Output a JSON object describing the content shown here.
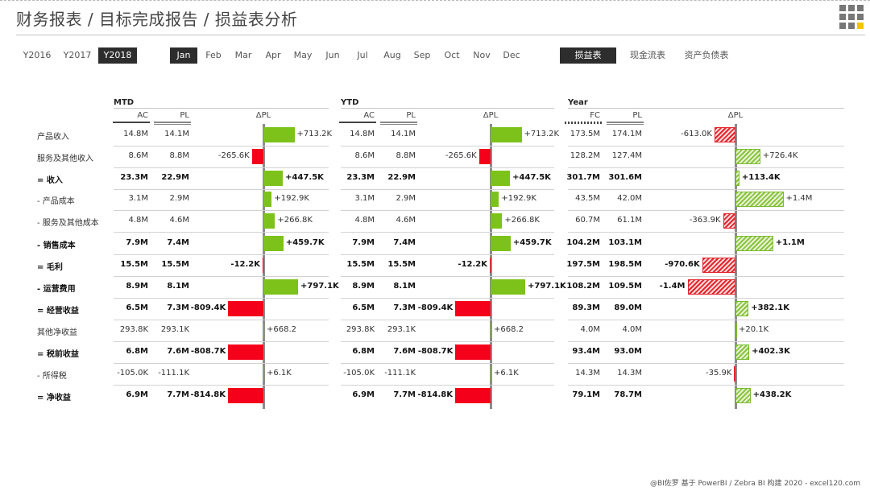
{
  "title": "财务报表 / 目标完成报告 / 损益表分析",
  "years": [
    {
      "label": "Y2016",
      "active": false
    },
    {
      "label": "Y2017",
      "active": false
    },
    {
      "label": "Y2018",
      "active": true
    }
  ],
  "months": [
    {
      "label": "Jan",
      "active": true
    },
    {
      "label": "Feb",
      "active": false
    },
    {
      "label": "Mar",
      "active": false
    },
    {
      "label": "Apr",
      "active": false
    },
    {
      "label": "May",
      "active": false
    },
    {
      "label": "Jun",
      "active": false
    },
    {
      "label": "Jul",
      "active": false
    },
    {
      "label": "Aug",
      "active": false
    },
    {
      "label": "Sep",
      "active": false
    },
    {
      "label": "Oct",
      "active": false
    },
    {
      "label": "Nov",
      "active": false
    },
    {
      "label": "Dec",
      "active": false
    }
  ],
  "reports": [
    {
      "label": "损益表",
      "active": true
    },
    {
      "label": "现金流表",
      "active": false
    },
    {
      "label": "资产负债表",
      "active": false
    }
  ],
  "rows": [
    {
      "label": "产品收入",
      "bold": false
    },
    {
      "label": "服务及其他收入",
      "bold": false
    },
    {
      "label": "= 收入",
      "bold": true
    },
    {
      "label": "- 产品成本",
      "bold": false
    },
    {
      "label": "- 服务及其他成本",
      "bold": false
    },
    {
      "label": "- 销售成本",
      "bold": true
    },
    {
      "label": "= 毛利",
      "bold": true
    },
    {
      "label": "- 运营费用",
      "bold": true
    },
    {
      "label": "= 经营收益",
      "bold": true
    },
    {
      "label": "其他净收益",
      "bold": false
    },
    {
      "label": "= 税前收益",
      "bold": true
    },
    {
      "label": "- 所得税",
      "bold": false
    },
    {
      "label": "= 净收益",
      "bold": true
    }
  ],
  "sections": [
    {
      "label": "MTD",
      "col1": "AC",
      "col2": "PL",
      "delta": "ΔPL",
      "c1": [
        "14.8M",
        "8.6M",
        "23.3M",
        "3.1M",
        "4.8M",
        "7.9M",
        "15.5M",
        "8.9M",
        "6.5M",
        "293.8K",
        "6.8M",
        "-105.0K",
        "6.9M"
      ],
      "c2": [
        "14.1M",
        "8.8M",
        "22.9M",
        "2.9M",
        "4.6M",
        "7.4M",
        "15.5M",
        "8.1M",
        "7.3M",
        "293.1K",
        "7.6M",
        "-111.1K",
        "7.7M"
      ],
      "delta_labels": [
        "+713.2K",
        "-265.6K",
        "+447.5K",
        "+192.9K",
        "+266.8K",
        "+459.7K",
        "-12.2K",
        "+797.1K",
        "-809.4K",
        "+668.2",
        "-808.7K",
        "+6.1K",
        "-814.8K"
      ]
    },
    {
      "label": "YTD",
      "col1": "AC",
      "col2": "PL",
      "delta": "ΔPL",
      "c1": [
        "14.8M",
        "8.6M",
        "23.3M",
        "3.1M",
        "4.8M",
        "7.9M",
        "15.5M",
        "8.9M",
        "6.5M",
        "293.8K",
        "6.8M",
        "-105.0K",
        "6.9M"
      ],
      "c2": [
        "14.1M",
        "8.8M",
        "22.9M",
        "2.9M",
        "4.6M",
        "7.4M",
        "15.5M",
        "8.1M",
        "7.3M",
        "293.1K",
        "7.6M",
        "-111.1K",
        "7.7M"
      ],
      "delta_labels": [
        "+713.2K",
        "-265.6K",
        "+447.5K",
        "+192.9K",
        "+266.8K",
        "+459.7K",
        "-12.2K",
        "+797.1K",
        "-809.4K",
        "+668.2",
        "-808.7K",
        "+6.1K",
        "-814.8K"
      ]
    },
    {
      "label": "Year",
      "col1": "FC",
      "col2": "PL",
      "delta": "ΔPL",
      "c1": [
        "173.5M",
        "128.2M",
        "301.7M",
        "43.5M",
        "60.7M",
        "104.2M",
        "197.5M",
        "108.2M",
        "89.3M",
        "4.0M",
        "93.4M",
        "14.3M",
        "79.1M"
      ],
      "c2": [
        "174.1M",
        "127.4M",
        "301.6M",
        "42.0M",
        "61.1M",
        "103.1M",
        "198.5M",
        "109.5M",
        "89.0M",
        "4.0M",
        "93.0M",
        "14.3M",
        "78.7M"
      ],
      "delta_labels": [
        "-613.0K",
        "+726.4K",
        "+113.4K",
        "+1.4M",
        "-363.9K",
        "+1.1M",
        "-970.6K",
        "-1.4M",
        "+382.1K",
        "+20.1K",
        "+402.3K",
        "-35.9K",
        "+438.2K"
      ]
    }
  ],
  "chart_data": [
    {
      "type": "bar",
      "title": "MTD ΔPL",
      "categories": [
        "产品收入",
        "服务及其他收入",
        "收入",
        "产品成本",
        "服务及其他成本",
        "销售成本",
        "毛利",
        "运营费用",
        "经营收益",
        "其他净收益",
        "税前收益",
        "所得税",
        "净收益"
      ],
      "values": [
        713.2,
        -265.6,
        447.5,
        192.9,
        266.8,
        459.7,
        -12.2,
        797.1,
        -809.4,
        0.668,
        -808.7,
        6.1,
        -814.8
      ],
      "unit": "K"
    },
    {
      "type": "bar",
      "title": "YTD ΔPL",
      "categories": [
        "产品收入",
        "服务及其他收入",
        "收入",
        "产品成本",
        "服务及其他成本",
        "销售成本",
        "毛利",
        "运营费用",
        "经营收益",
        "其他净收益",
        "税前收益",
        "所得税",
        "净收益"
      ],
      "values": [
        713.2,
        -265.6,
        447.5,
        192.9,
        266.8,
        459.7,
        -12.2,
        797.1,
        -809.4,
        0.668,
        -808.7,
        6.1,
        -814.8
      ],
      "unit": "K"
    },
    {
      "type": "bar",
      "title": "Year ΔPL",
      "categories": [
        "产品收入",
        "服务及其他收入",
        "收入",
        "产品成本",
        "服务及其他成本",
        "销售成本",
        "毛利",
        "运营费用",
        "经营收益",
        "其他净收益",
        "税前收益",
        "所得税",
        "净收益"
      ],
      "values": [
        -613.0,
        726.4,
        113.4,
        1400,
        -363.9,
        1100,
        -970.6,
        -1400,
        382.1,
        20.1,
        402.3,
        -35.9,
        438.2
      ],
      "unit": "K"
    }
  ],
  "footer": "@BI佐罗   基于 PowerBI / Zebra BI 构建 2020 - excel120.com",
  "colors": {
    "positive": "#7dc21b",
    "negative": "#f5001a",
    "active_tab": "#2d2d2d"
  }
}
